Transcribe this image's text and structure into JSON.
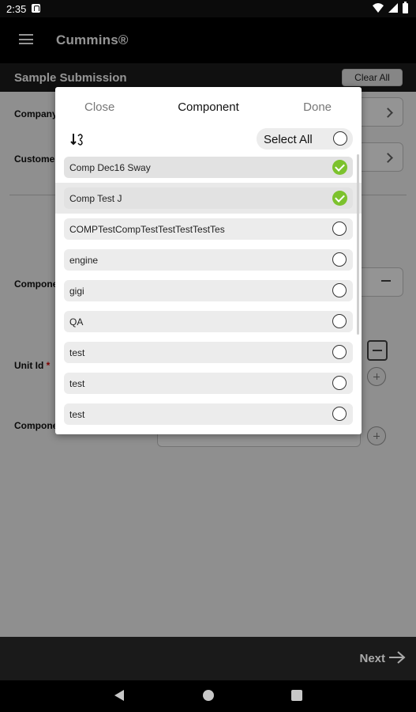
{
  "status_bar": {
    "time": "2:35"
  },
  "app": {
    "title": "Cummins®"
  },
  "section": {
    "title": "Sample Submission",
    "clear_all": "Clear All"
  },
  "form": {
    "company_label": "Company",
    "customer_label": "Customer",
    "component_label": "Component",
    "unit_id_label": "Unit Id",
    "unit_id_required": "*",
    "component2_label": "Component"
  },
  "footer": {
    "next_label": "Next"
  },
  "modal": {
    "close_label": "Close",
    "title": "Component",
    "done_label": "Done",
    "select_all_label": "Select All",
    "items": [
      {
        "label": "Comp Dec16 Sway",
        "checked": true
      },
      {
        "label": "Comp Test J",
        "checked": true
      },
      {
        "label": "COMPTestCompTestTestTestTestTes",
        "checked": false
      },
      {
        "label": "engine",
        "checked": false
      },
      {
        "label": "gigi",
        "checked": false
      },
      {
        "label": "QA",
        "checked": false
      },
      {
        "label": "test",
        "checked": false
      },
      {
        "label": "test",
        "checked": false
      },
      {
        "label": "test",
        "checked": false
      }
    ]
  },
  "colors": {
    "check_green": "#7cc22d"
  }
}
